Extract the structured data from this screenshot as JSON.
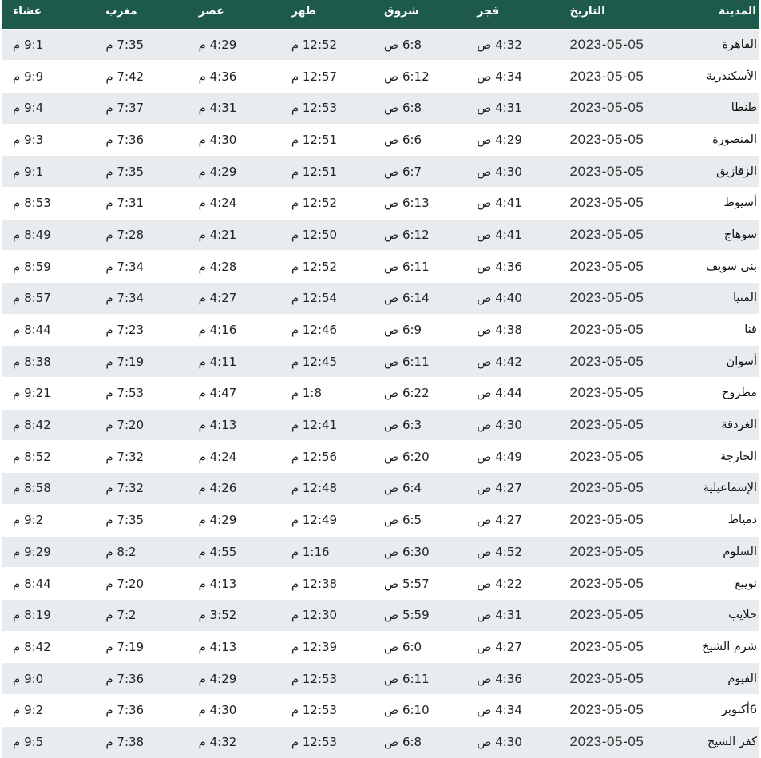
{
  "table": {
    "headers": {
      "city": "المدينة",
      "date": "التاريخ",
      "fajr": "فجر",
      "shurooq": "شروق",
      "dhuhr": "ظهر",
      "asr": "عصر",
      "maghrib": "مغرب",
      "isha": "عشاء"
    },
    "rows": [
      {
        "city": "القاهرة",
        "date": "2023-05-05",
        "fajr": "4:32 ص",
        "shurooq": "6:8 ص",
        "dhuhr": "12:52 م",
        "asr": "4:29 م",
        "maghrib": "7:35 م",
        "isha": "9:1 م"
      },
      {
        "city": "الأسكندرية",
        "date": "2023-05-05",
        "fajr": "4:34 ص",
        "shurooq": "6:12 ص",
        "dhuhr": "12:57 م",
        "asr": "4:36 م",
        "maghrib": "7:42 م",
        "isha": "9:9 م"
      },
      {
        "city": "طنطا",
        "date": "2023-05-05",
        "fajr": "4:31 ص",
        "shurooq": "6:8 ص",
        "dhuhr": "12:53 م",
        "asr": "4:31 م",
        "maghrib": "7:37 م",
        "isha": "9:4 م"
      },
      {
        "city": "المنصورة",
        "date": "2023-05-05",
        "fajr": "4:29 ص",
        "shurooq": "6:6 ص",
        "dhuhr": "12:51 م",
        "asr": "4:30 م",
        "maghrib": "7:36 م",
        "isha": "9:3 م"
      },
      {
        "city": "الزقازيق",
        "date": "2023-05-05",
        "fajr": "4:30 ص",
        "shurooq": "6:7 ص",
        "dhuhr": "12:51 م",
        "asr": "4:29 م",
        "maghrib": "7:35 م",
        "isha": "9:1 م"
      },
      {
        "city": "أسيوط",
        "date": "2023-05-05",
        "fajr": "4:41 ص",
        "shurooq": "6:13 ص",
        "dhuhr": "12:52 م",
        "asr": "4:24 م",
        "maghrib": "7:31 م",
        "isha": "8:53 م"
      },
      {
        "city": "سوهاج",
        "date": "2023-05-05",
        "fajr": "4:41 ص",
        "shurooq": "6:12 ص",
        "dhuhr": "12:50 م",
        "asr": "4:21 م",
        "maghrib": "7:28 م",
        "isha": "8:49 م"
      },
      {
        "city": "بنى سويف",
        "date": "2023-05-05",
        "fajr": "4:36 ص",
        "shurooq": "6:11 ص",
        "dhuhr": "12:52 م",
        "asr": "4:28 م",
        "maghrib": "7:34 م",
        "isha": "8:59 م"
      },
      {
        "city": "المنيا",
        "date": "2023-05-05",
        "fajr": "4:40 ص",
        "shurooq": "6:14 ص",
        "dhuhr": "12:54 م",
        "asr": "4:27 م",
        "maghrib": "7:34 م",
        "isha": "8:57 م"
      },
      {
        "city": "قنا",
        "date": "2023-05-05",
        "fajr": "4:38 ص",
        "shurooq": "6:9 ص",
        "dhuhr": "12:46 م",
        "asr": "4:16 م",
        "maghrib": "7:23 م",
        "isha": "8:44 م"
      },
      {
        "city": "أسوان",
        "date": "2023-05-05",
        "fajr": "4:42 ص",
        "shurooq": "6:11 ص",
        "dhuhr": "12:45 م",
        "asr": "4:11 م",
        "maghrib": "7:19 م",
        "isha": "8:38 م"
      },
      {
        "city": "مطروح",
        "date": "2023-05-05",
        "fajr": "4:44 ص",
        "shurooq": "6:22 ص",
        "dhuhr": "1:8 م",
        "asr": "4:47 م",
        "maghrib": "7:53 م",
        "isha": "9:21 م"
      },
      {
        "city": "الغردقة",
        "date": "2023-05-05",
        "fajr": "4:30 ص",
        "shurooq": "6:3 ص",
        "dhuhr": "12:41 م",
        "asr": "4:13 م",
        "maghrib": "7:20 م",
        "isha": "8:42 م"
      },
      {
        "city": "الخارجة",
        "date": "2023-05-05",
        "fajr": "4:49 ص",
        "shurooq": "6:20 ص",
        "dhuhr": "12:56 م",
        "asr": "4:24 م",
        "maghrib": "7:32 م",
        "isha": "8:52 م"
      },
      {
        "city": "الإسماعيلية",
        "date": "2023-05-05",
        "fajr": "4:27 ص",
        "shurooq": "6:4 ص",
        "dhuhr": "12:48 م",
        "asr": "4:26 م",
        "maghrib": "7:32 م",
        "isha": "8:58 م"
      },
      {
        "city": "دمياط",
        "date": "2023-05-05",
        "fajr": "4:27 ص",
        "shurooq": "6:5 ص",
        "dhuhr": "12:49 م",
        "asr": "4:29 م",
        "maghrib": "7:35 م",
        "isha": "9:2 م"
      },
      {
        "city": "السلوم",
        "date": "2023-05-05",
        "fajr": "4:52 ص",
        "shurooq": "6:30 ص",
        "dhuhr": "1:16 م",
        "asr": "4:55 م",
        "maghrib": "8:2 م",
        "isha": "9:29 م"
      },
      {
        "city": "نويبع",
        "date": "2023-05-05",
        "fajr": "4:22 ص",
        "shurooq": "5:57 ص",
        "dhuhr": "12:38 م",
        "asr": "4:13 م",
        "maghrib": "7:20 م",
        "isha": "8:44 م"
      },
      {
        "city": "حلايب",
        "date": "2023-05-05",
        "fajr": "4:31 ص",
        "shurooq": "5:59 ص",
        "dhuhr": "12:30 م",
        "asr": "3:52 م",
        "maghrib": "7:2 م",
        "isha": "8:19 م"
      },
      {
        "city": "شرم الشيخ",
        "date": "2023-05-05",
        "fajr": "4:27 ص",
        "shurooq": "6:0 ص",
        "dhuhr": "12:39 م",
        "asr": "4:13 م",
        "maghrib": "7:19 م",
        "isha": "8:42 م"
      },
      {
        "city": "الفيوم",
        "date": "2023-05-05",
        "fajr": "4:36 ص",
        "shurooq": "6:11 ص",
        "dhuhr": "12:53 م",
        "asr": "4:29 م",
        "maghrib": "7:36 م",
        "isha": "9:0 م"
      },
      {
        "city": "6أكتوبر",
        "date": "2023-05-05",
        "fajr": "4:34 ص",
        "shurooq": "6:10 ص",
        "dhuhr": "12:53 م",
        "asr": "4:30 م",
        "maghrib": "7:36 م",
        "isha": "9:2 م"
      },
      {
        "city": "كفر الشيخ",
        "date": "2023-05-05",
        "fajr": "4:30 ص",
        "shurooq": "6:8 ص",
        "dhuhr": "12:53 م",
        "asr": "4:32 م",
        "maghrib": "7:38 م",
        "isha": "9:5 م"
      }
    ]
  },
  "colors": {
    "header_bg": "#1e5a4b",
    "header_text": "#ffffff",
    "row_stripe": "#e8ecee",
    "row_plain": "#ffffff"
  }
}
